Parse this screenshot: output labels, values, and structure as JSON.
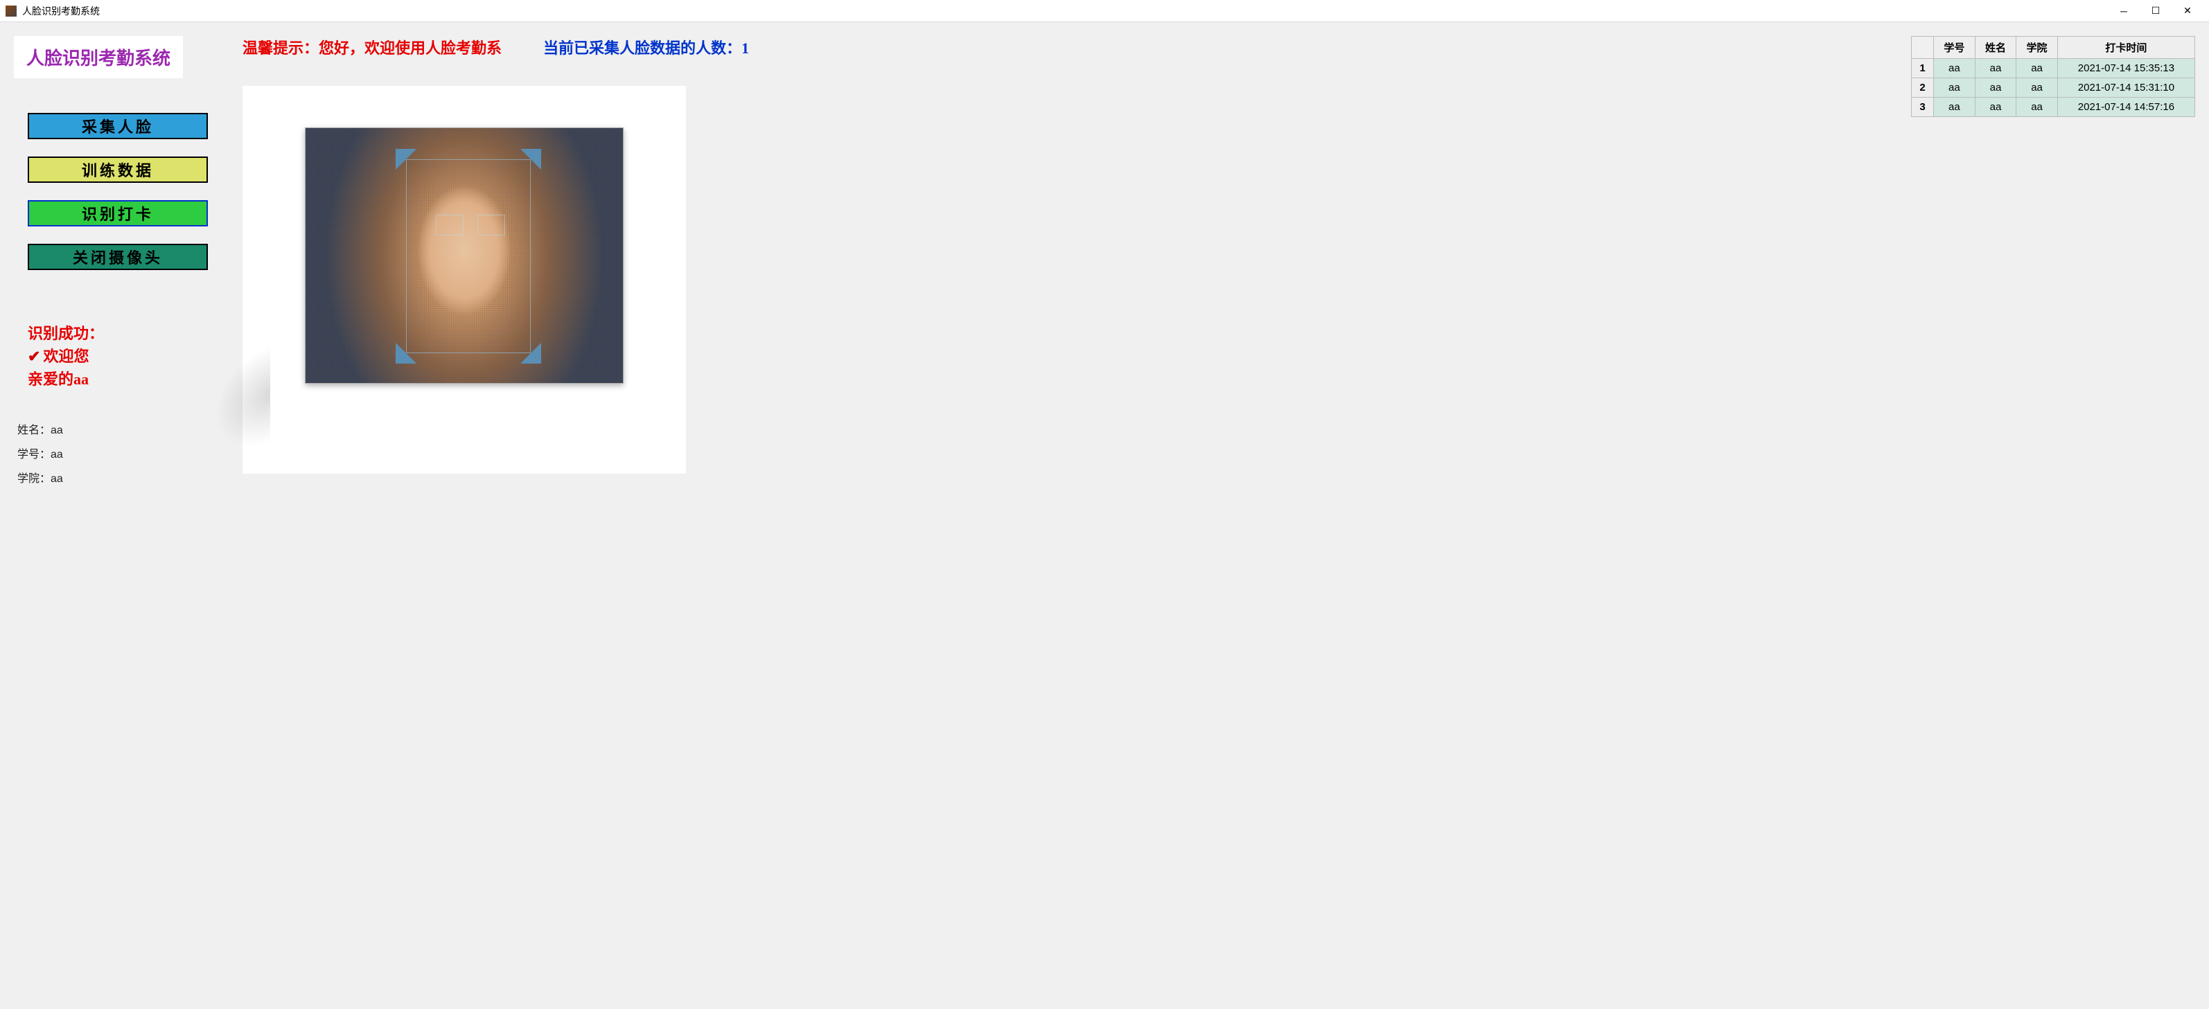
{
  "window": {
    "title": "人脸识别考勤系统"
  },
  "sidebar": {
    "appTitle": "人脸识别考勤系统",
    "buttons": {
      "collect": "采集人脸",
      "train": "训练数据",
      "recognize": "识别打卡",
      "closeCam": "关闭摄像头"
    },
    "status": {
      "line1": "识别成功：",
      "line2": "欢迎您",
      "line3": "亲爱的aa"
    },
    "info": {
      "nameLabel": "姓名：",
      "nameValue": "aa",
      "idLabel": "学号：",
      "idValue": "aa",
      "collegeLabel": "学院：",
      "collegeValue": "aa"
    }
  },
  "top": {
    "hint": "温馨提示：您好，欢迎使用人脸考勤系",
    "countLabel": "当前已采集人脸数据的人数：",
    "countValue": "1"
  },
  "table": {
    "headers": [
      "",
      "学号",
      "姓名",
      "学院",
      "打卡时间"
    ],
    "rows": [
      {
        "idx": "1",
        "sid": "aa",
        "name": "aa",
        "college": "aa",
        "time": "2021-07-14 15:35:13"
      },
      {
        "idx": "2",
        "sid": "aa",
        "name": "aa",
        "college": "aa",
        "time": "2021-07-14 15:31:10"
      },
      {
        "idx": "3",
        "sid": "aa",
        "name": "aa",
        "college": "aa",
        "time": "2021-07-14 14:57:16"
      }
    ]
  }
}
